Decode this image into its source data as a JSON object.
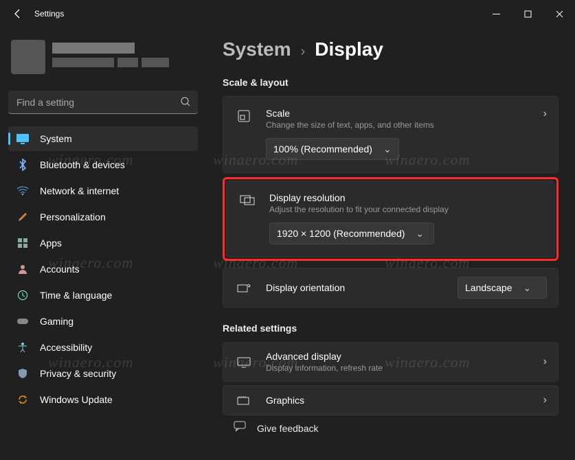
{
  "window": {
    "title": "Settings"
  },
  "search": {
    "placeholder": "Find a setting"
  },
  "nav": {
    "items": [
      {
        "label": "System"
      },
      {
        "label": "Bluetooth & devices"
      },
      {
        "label": "Network & internet"
      },
      {
        "label": "Personalization"
      },
      {
        "label": "Apps"
      },
      {
        "label": "Accounts"
      },
      {
        "label": "Time & language"
      },
      {
        "label": "Gaming"
      },
      {
        "label": "Accessibility"
      },
      {
        "label": "Privacy & security"
      },
      {
        "label": "Windows Update"
      }
    ]
  },
  "breadcrumb": {
    "root": "System",
    "current": "Display"
  },
  "sections": {
    "scale_layout": "Scale & layout",
    "related": "Related settings"
  },
  "cards": {
    "scale": {
      "title": "Scale",
      "sub": "Change the size of text, apps, and other items",
      "value": "100% (Recommended)"
    },
    "resolution": {
      "title": "Display resolution",
      "sub": "Adjust the resolution to fit your connected display",
      "value": "1920 × 1200 (Recommended)"
    },
    "orientation": {
      "title": "Display orientation",
      "value": "Landscape"
    },
    "advanced": {
      "title": "Advanced display",
      "sub": "Display information, refresh rate"
    },
    "graphics": {
      "title": "Graphics"
    },
    "feedback": {
      "title": "Give feedback"
    }
  },
  "watermark": "winaero.com"
}
